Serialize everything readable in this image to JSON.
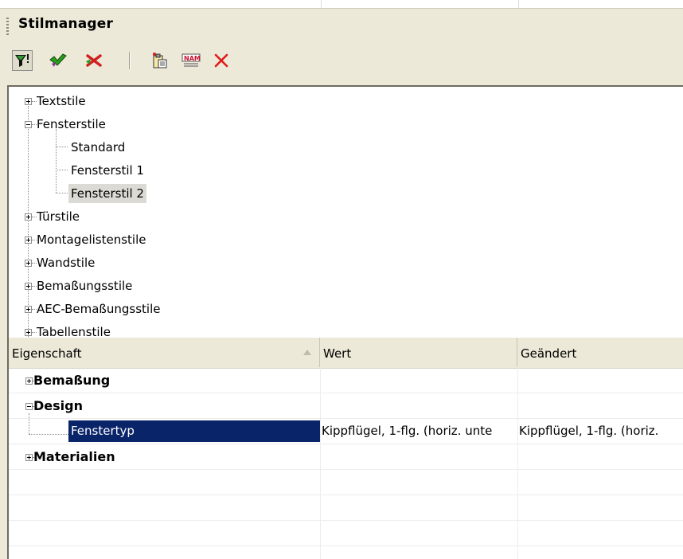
{
  "panel": {
    "title": "Stilmanager"
  },
  "toolbar": {
    "buttons": [
      {
        "icon": "filter-icon",
        "pressed": true
      },
      {
        "icon": "check-green-icon"
      },
      {
        "icon": "uncheck-red-icon"
      },
      {
        "icon": "clipboard-icon"
      },
      {
        "icon": "name-icon",
        "text": "NAM"
      },
      {
        "icon": "delete-x-icon"
      }
    ]
  },
  "tree": {
    "items": [
      {
        "label": "Textstile"
      },
      {
        "label": "Fensterstile"
      },
      {
        "label": "Standard"
      },
      {
        "label": "Fensterstil 1"
      },
      {
        "label": "Fensterstil 2",
        "selected": true
      },
      {
        "label": "Türstile"
      },
      {
        "label": "Montagelistenstile"
      },
      {
        "label": "Wandstile"
      },
      {
        "label": "Bemaßungsstile"
      },
      {
        "label": "AEC-Bemaßungsstile"
      },
      {
        "label": "Tabellenstile"
      }
    ]
  },
  "properties": {
    "columns": [
      "Eigenschaft",
      "Wert",
      "Geändert"
    ],
    "rows": [
      {
        "name": "Bemaßung",
        "type": "group",
        "expanded": false,
        "value": "",
        "changed": ""
      },
      {
        "name": "Design",
        "type": "group",
        "expanded": true,
        "value": "",
        "changed": ""
      },
      {
        "name": "Fenstertyp",
        "type": "item",
        "selected": true,
        "value": "Kippflügel, 1-flg. (horiz. unte",
        "changed": "Kippflügel, 1-flg. (horiz."
      },
      {
        "name": "Materialien",
        "type": "group",
        "expanded": false,
        "value": "",
        "changed": ""
      }
    ]
  },
  "colors": {
    "selection": "#0a246a",
    "panel_bg": "#ece9d8"
  }
}
